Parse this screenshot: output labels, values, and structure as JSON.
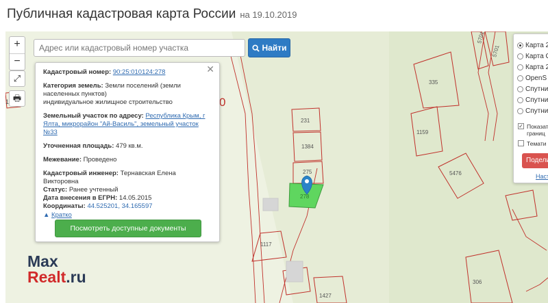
{
  "header": {
    "title": "Публичная кадастровая карта России",
    "date": "на 19.10.2019"
  },
  "search": {
    "placeholder": "Адрес или кадастровый номер участка",
    "button_label": "Найти"
  },
  "map_controls": {
    "zoom_in": "+",
    "zoom_out": "−"
  },
  "popup": {
    "cadastral_number_label": "Кадастровый номер:",
    "cadastral_number": "90:25:010124:278",
    "category_label": "Категория земель:",
    "category_value": "Земли поселений (земли населенных пунктов)",
    "usage_value": "индивидуальное жилищное строительство",
    "address_label": "Земельный участок по адресу:",
    "address_value": "Республика Крым, г Ялта, микрорайон \"Ай-Василь\", земельный участок №33",
    "area_label": "Уточненная площадь:",
    "area_value": "479 кв.м.",
    "survey_label": "Межевание:",
    "survey_value": "Проведено",
    "engineer_label": "Кадастровый инженер:",
    "engineer_value": "Тернавская Елена Викторовна",
    "status_label": "Статус:",
    "status_value": "Ранее учтенный",
    "egrn_label": "Дата внесения в ЕГРН:",
    "egrn_value": "14.05.2015",
    "coords_label": "Координаты:",
    "coords_value": "44.525201, 34.165597",
    "brief_link": "Кратко",
    "docs_button": "Посмотреть доступные документы"
  },
  "layers": {
    "options": [
      "Карта 2",
      "Карта G",
      "Карта 2",
      "OpenS",
      "Спутни",
      "Спутни",
      "Спутни"
    ],
    "selected_index": 0,
    "check_show": "Показат границ",
    "check_thematic": "Темати",
    "share_button": "Подели",
    "settings_link": "Наст"
  },
  "map_labels": {
    "parcel_231": "231",
    "parcel_1384": "1384",
    "parcel_275": "275",
    "parcel_278": "278",
    "parcel_1117": "1117",
    "parcel_1427": "1427",
    "parcel_335": "335",
    "parcel_1159": "1159",
    "parcel_5476": "5476",
    "parcel_306": "306",
    "parcel_5701a": "5701",
    "parcel_5701b": "5701",
    "parcel_10": "10",
    "parcel_0": "0"
  },
  "watermark": {
    "max": "Max",
    "realt": "Realt",
    "dot": ".",
    "ru": "ru"
  },
  "colors": {
    "parcel_stroke": "#c0302a",
    "selected_fill": "#5fd65f",
    "search_button": "#2e7bc4",
    "docs_button": "#4cae4c",
    "share_button": "#d9534f",
    "marker": "#2a83c8"
  }
}
